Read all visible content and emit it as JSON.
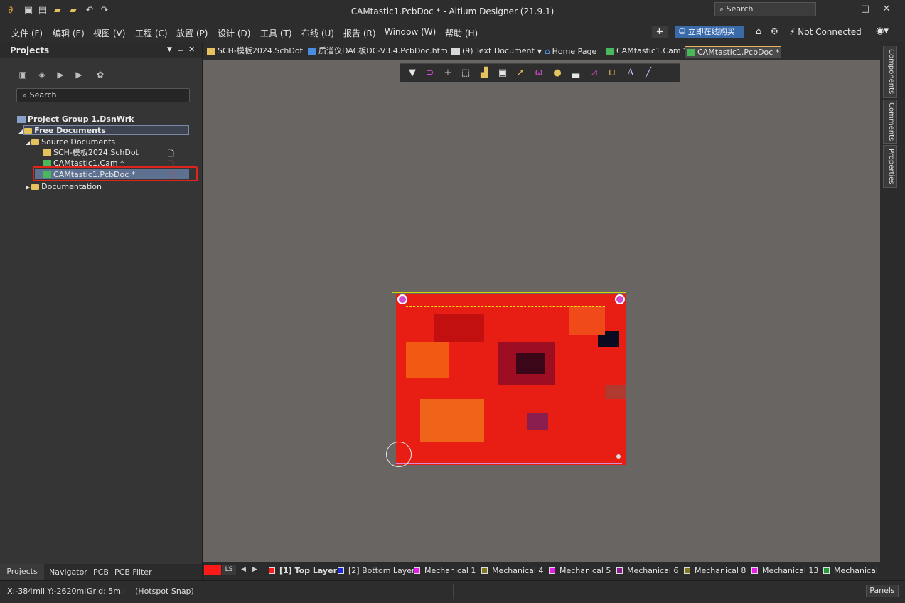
{
  "window": {
    "title": "CAMtastic1.PcbDoc * - Altium Designer (21.9.1)",
    "search_placeholder": "Search"
  },
  "menu": [
    "文件 (F)",
    "编辑 (E)",
    "视图 (V)",
    "工程 (C)",
    "放置 (P)",
    "设计 (D)",
    "工具 (T)",
    "布线 (U)",
    "报告 (R)",
    "Window (W)",
    "帮助 (H)"
  ],
  "menu_right": {
    "buy_label": "立即在线购买",
    "connection": "Not Connected"
  },
  "projects_panel": {
    "title": "Projects",
    "search_placeholder": "Search",
    "tree": {
      "group": "Project Group 1.DsnWrk",
      "free_documents": "Free Documents",
      "source_documents": "Source Documents",
      "docs": [
        "SCH-模板2024.SchDot",
        "CAMtastic1.Cam *",
        "CAMtastic1.PcbDoc *"
      ],
      "documentation": "Documentation"
    },
    "bottom_tabs": [
      "Projects",
      "Navigator",
      "PCB",
      "PCB Filter"
    ]
  },
  "doc_tabs": [
    "SCH-模板2024.SchDot",
    "质谱仪DAC板DC-V3.4.PcbDoc.htm",
    "(9) Text Document",
    "Home Page",
    "CAMtastic1.Cam *",
    "CAMtastic1.PcbDoc *"
  ],
  "right_tabs": [
    "Components",
    "Comments",
    "Properties"
  ],
  "layers": {
    "ls_label": "LS",
    "items": [
      {
        "label": "[1] Top Layer",
        "color": "#ff1a1a",
        "active": true
      },
      {
        "label": "[2] Bottom Layer",
        "color": "#1f2bd6"
      },
      {
        "label": "Mechanical 1",
        "color": "#e81ee8"
      },
      {
        "label": "Mechanical 4",
        "color": "#807820"
      },
      {
        "label": "Mechanical 5",
        "color": "#e81ee8"
      },
      {
        "label": "Mechanical 6",
        "color": "#8a1a8a"
      },
      {
        "label": "Mechanical 8",
        "color": "#807820"
      },
      {
        "label": "Mechanical 13",
        "color": "#e81ee8"
      },
      {
        "label": "Mechanical",
        "color": "#1f9a3a"
      }
    ]
  },
  "status": {
    "coords": "X:-384mil Y:-2620mil",
    "grid": "Grid: 5mil",
    "snap": "(Hotspot Snap)",
    "panels_button": "Panels"
  },
  "colors": {
    "canvas_bg": "#696563",
    "board_red": "#e81e14",
    "selection_red": "#e0241a",
    "accent_blue": "#3b6aa8"
  }
}
